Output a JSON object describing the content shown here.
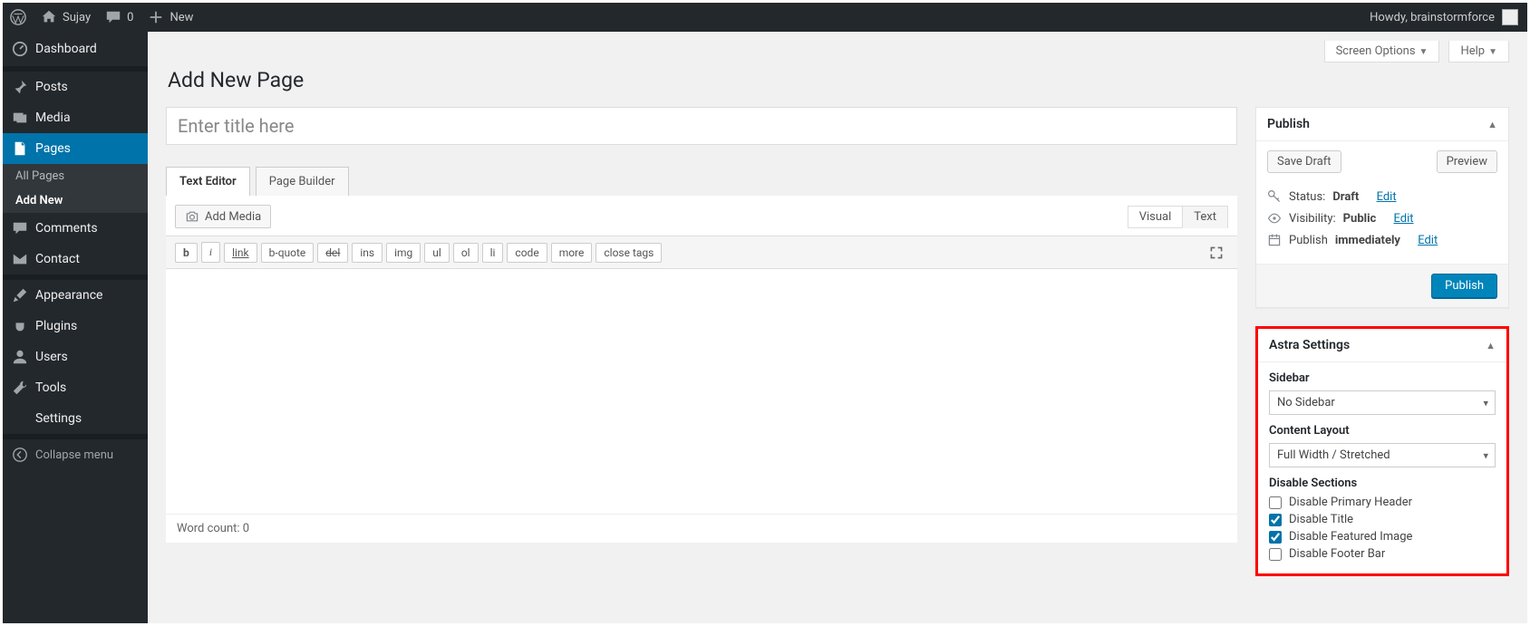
{
  "adminbar": {
    "site_name": "Sujay",
    "comments": "0",
    "new": "New",
    "howdy": "Howdy, brainstormforce"
  },
  "sidebar": {
    "dashboard": "Dashboard",
    "items": [
      {
        "label": "Posts"
      },
      {
        "label": "Media"
      },
      {
        "label": "Pages"
      },
      {
        "label": "Comments"
      },
      {
        "label": "Contact"
      },
      {
        "label": "Appearance"
      },
      {
        "label": "Plugins"
      },
      {
        "label": "Users"
      },
      {
        "label": "Tools"
      },
      {
        "label": "Settings"
      }
    ],
    "submenu": {
      "all": "All Pages",
      "add": "Add New"
    },
    "collapse": "Collapse menu"
  },
  "top_tabs": {
    "screen_options": "Screen Options",
    "help": "Help"
  },
  "page_title": "Add New Page",
  "title_placeholder": "Enter title here",
  "ed_tabs": {
    "text": "Text Editor",
    "pb": "Page Builder"
  },
  "add_media": "Add Media",
  "view_tabs": {
    "visual": "Visual",
    "text": "Text"
  },
  "qt": [
    "b",
    "i",
    "link",
    "b-quote",
    "del",
    "ins",
    "img",
    "ul",
    "ol",
    "li",
    "code",
    "more",
    "close tags"
  ],
  "word_count_label": "Word count:",
  "word_count": "0",
  "publish": {
    "title": "Publish",
    "save": "Save Draft",
    "preview": "Preview",
    "status_label": "Status:",
    "status_value": "Draft",
    "visibility_label": "Visibility:",
    "visibility_value": "Public",
    "publish_label": "Publish",
    "publish_value": "immediately",
    "edit": "Edit",
    "button": "Publish"
  },
  "astra": {
    "title": "Astra Settings",
    "sidebar_label": "Sidebar",
    "sidebar_value": "No Sidebar",
    "content_label": "Content Layout",
    "content_value": "Full Width / Stretched",
    "disable_label": "Disable Sections",
    "opts": [
      {
        "label": "Disable Primary Header",
        "checked": false
      },
      {
        "label": "Disable Title",
        "checked": true
      },
      {
        "label": "Disable Featured Image",
        "checked": true
      },
      {
        "label": "Disable Footer Bar",
        "checked": false
      }
    ]
  }
}
